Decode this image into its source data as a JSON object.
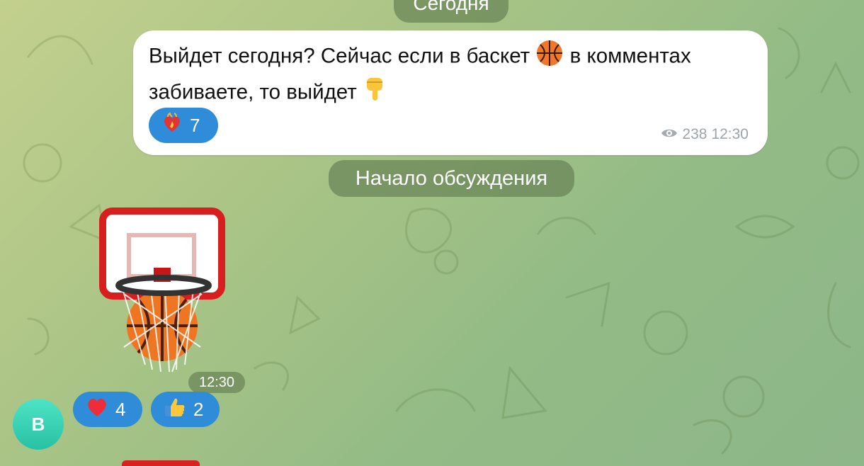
{
  "date_separator": "Сегодня",
  "post": {
    "text_part1": "Выйдет сегодня? Сейчас если в баскет",
    "text_part2": "в комментах",
    "text_line2": "забиваете, то выйдет",
    "emoji_ball": "basketball-icon",
    "emoji_point": "pointing-down-hand-icon",
    "reaction": {
      "icon": "heart-on-fire-icon",
      "count": "7"
    },
    "views": "238",
    "time": "12:30"
  },
  "discussion_label": "Начало обсуждения",
  "comment": {
    "sticker": "basketball-hoop-sticker",
    "time": "12:30",
    "reactions": [
      {
        "icon": "red-heart-icon",
        "count": "4"
      },
      {
        "icon": "thumbs-up-icon",
        "count": "2"
      }
    ],
    "author_initial": "В",
    "avatar_color": "#3ed6b7"
  },
  "colors": {
    "reaction_blue": "#2f8cd9",
    "pill_bg": "#688456"
  }
}
